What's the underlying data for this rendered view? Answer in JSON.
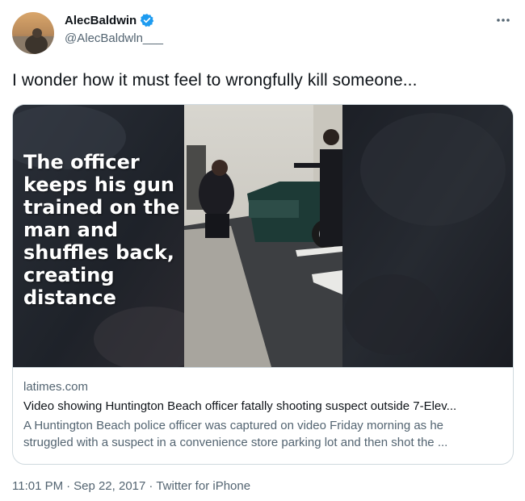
{
  "author": {
    "display_name": "AlecBaldwin",
    "handle": "@AlecBaldwln___",
    "verified": true
  },
  "tweet": {
    "text": "I wonder how it must feel to wrongfully kill someone..."
  },
  "card": {
    "overlay_text": "The officer keeps his gun trained on the man and shuffles back, creating distance",
    "domain": "latimes.com",
    "title": "Video showing Huntington Beach officer fatally shooting suspect outside 7-Elev...",
    "description_line1": "A Huntington Beach police officer was captured on video Friday morning as he",
    "description_line2": "struggled with a suspect in a convenience store parking lot and then shot the ..."
  },
  "meta": {
    "time": "11:01 PM",
    "sep1": "·",
    "date": "Sep 22, 2017",
    "sep2": "·",
    "source": "Twitter for iPhone"
  },
  "colors": {
    "verified_blue": "#1d9bf0",
    "secondary_text": "#536471",
    "border": "#cfd9de"
  },
  "icons": [
    "avatar",
    "verified-badge-icon",
    "more-options-icon"
  ]
}
